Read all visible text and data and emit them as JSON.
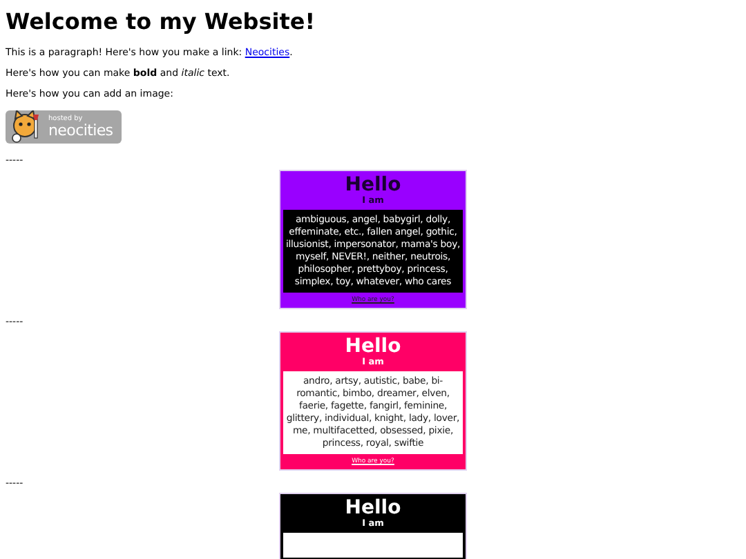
{
  "heading": "Welcome to my Website!",
  "paragraphs": [
    {
      "before": "This is a paragraph! Here's how you make a link: ",
      "link": "Neocities",
      "after": "."
    },
    {
      "text": "Here's how you can make **bold** and *italic* text."
    },
    {
      "text": "Here's how you can add an image:"
    }
  ],
  "badge": {
    "line_1": "hosted by",
    "line_2": "neocities"
  },
  "separator": "-----",
  "cards": [
    {
      "kind": "dark",
      "color": "#9900ff",
      "title": "Hello",
      "subtitle": "I am",
      "words": "ambiguous, angel, babygirl, dolly, effeminate, etc., fallen angel, gothic, illusionist, impersonator, mama's boy, myself, NEVER!, neither, neutrois, philosopher, prettyboy, princess, simplex, toy, whatever, who cares",
      "link": "Who are you?"
    },
    {
      "kind": "light",
      "color": "#ff0066",
      "title": "Hello",
      "subtitle": "I am",
      "words": "andro, artsy, autistic, babe, bi-romantic, bimbo, dreamer, elven, faerie, fagette, fangirl, feminine, glittery, individual, knight, lady, lover, me, multifacetted, obsessed, pixie, princess, royal, swiftie",
      "link": "Who are you?"
    },
    {
      "kind": "light",
      "color": "#000000",
      "title": "Hello",
      "subtitle": "I am"
    }
  ]
}
